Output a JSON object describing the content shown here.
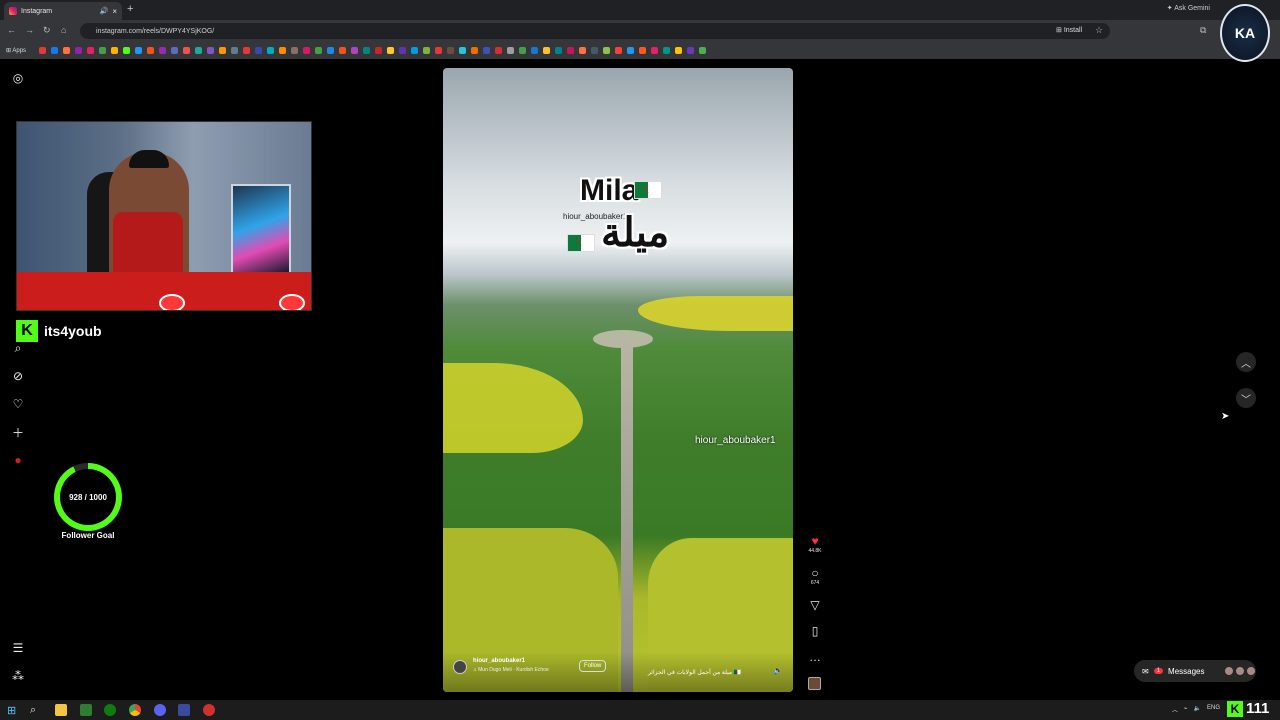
{
  "browser": {
    "tab_title": "Instagram",
    "tab_close": "×",
    "new_tab": "+",
    "url": "instagram.com/reels/DWPY4YSjKOG/",
    "install_label": "Install",
    "ask_gemini_label": "Ask Gemini",
    "apps_label": "Apps",
    "bookmark_colors": [
      "#e53935",
      "#1877f2",
      "#ff7043",
      "#8e24aa",
      "#e91e63",
      "#43a047",
      "#ffb300",
      "#53fc18",
      "#2196f3",
      "#f4511e",
      "#9c27b0",
      "#5c6bc0",
      "#ef5350",
      "#26a69a",
      "#7e57c2",
      "#ff9800",
      "#607d8b",
      "#e53935",
      "#3949ab",
      "#00acc1",
      "#fb8c00",
      "#8d6e63",
      "#d81b60",
      "#43a047",
      "#1e88e5",
      "#f4511e",
      "#ab47bc",
      "#00897b",
      "#c62828",
      "#ffca28",
      "#5e35b1",
      "#039be5",
      "#7cb342",
      "#e53935",
      "#6d4c41",
      "#26c6da",
      "#ef6c00",
      "#3f51b5",
      "#d32f2f",
      "#9e9e9e",
      "#43a047",
      "#1976d2",
      "#fbc02d",
      "#00838f",
      "#c2185b",
      "#ff7043",
      "#455a64",
      "#8bc34a",
      "#f44336",
      "#2196f3",
      "#ff5722",
      "#e91e63",
      "#009688",
      "#ffc107",
      "#673ab7",
      "#4caf50"
    ],
    "emblem_text": "KA"
  },
  "overlay": {
    "streamer_name": "its4youb",
    "goal_text": "928 / 1000",
    "goal_label": "Follower Goal",
    "goal_progress": 0.928
  },
  "reel": {
    "title_en": "Mila",
    "title_ar": "ميلة",
    "watermark_top": "hiour_aboubaker1",
    "watermark_mid": "hiour_aboubaker1",
    "author": "hiour_aboubaker1",
    "audio_line": "♫ Mun Dugo Meli · Kurdish Echoe",
    "follow_label": "Follow",
    "caption": "ميلة من أجمل الولايات في الجزائر 🇩🇿",
    "likes": "44.8K",
    "comments": "674"
  },
  "nav": {
    "messages_label": "Messages",
    "messages_badge": "1"
  },
  "taskbar": {
    "tray_lang": "ENG",
    "kick_count": "111"
  }
}
